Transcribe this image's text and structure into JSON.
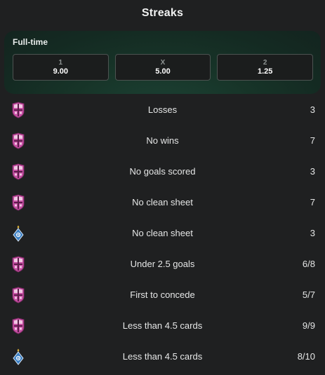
{
  "title": "Streaks",
  "odds": {
    "label": "Full-time",
    "options": [
      {
        "key": "1",
        "value": "9.00"
      },
      {
        "key": "X",
        "value": "5.00"
      },
      {
        "key": "2",
        "value": "1.25"
      }
    ]
  },
  "colors": {
    "background": "#1f2021",
    "card_green": "#173428",
    "home_badge": "#c64fa3",
    "away_badge": "#3a7fc4"
  },
  "streaks": [
    {
      "team_icon": "home-team-crest-icon",
      "label": "Losses",
      "value": "3"
    },
    {
      "team_icon": "home-team-crest-icon",
      "label": "No wins",
      "value": "7"
    },
    {
      "team_icon": "home-team-crest-icon",
      "label": "No goals scored",
      "value": "3"
    },
    {
      "team_icon": "home-team-crest-icon",
      "label": "No clean sheet",
      "value": "7"
    },
    {
      "team_icon": "away-team-crest-icon",
      "label": "No clean sheet",
      "value": "3"
    },
    {
      "team_icon": "home-team-crest-icon",
      "label": "Under 2.5 goals",
      "value": "6/8"
    },
    {
      "team_icon": "home-team-crest-icon",
      "label": "First to concede",
      "value": "5/7"
    },
    {
      "team_icon": "home-team-crest-icon",
      "label": "Less than 4.5 cards",
      "value": "9/9"
    },
    {
      "team_icon": "away-team-crest-icon",
      "label": "Less than 4.5 cards",
      "value": "8/10"
    }
  ]
}
